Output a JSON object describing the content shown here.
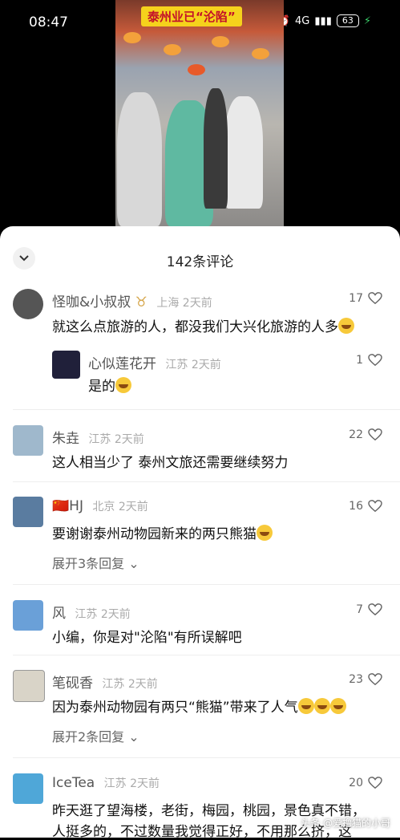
{
  "status_bar": {
    "time": "08:47",
    "network": "4G",
    "battery": "63"
  },
  "video": {
    "banner": "泰州业已“沦陷”"
  },
  "sheet": {
    "title": "142条评论"
  },
  "comments": [
    {
      "name": "怪咖&小叔叔",
      "badge": "♉",
      "location": "上海",
      "time": "2天前",
      "likes": "17",
      "text": "就这么点旅游的人，都没我们大兴化旅游的人多"
    },
    {
      "name": "心似莲花开",
      "location": "江苏",
      "time": "2天前",
      "likes": "1",
      "text": "是的"
    },
    {
      "name": "朱垚",
      "location": "江苏",
      "time": "2天前",
      "likes": "22",
      "text": "这人相当少了 泰州文旅还需要继续努力"
    },
    {
      "name": "HJ",
      "flag": "🇨🇳",
      "location": "北京",
      "time": "2天前",
      "likes": "16",
      "text": "要谢谢泰州动物园新来的两只熊猫",
      "expand": "展开3条回复"
    },
    {
      "name": "风",
      "location": "江苏",
      "time": "2天前",
      "likes": "7",
      "text": "小编，你是对\"沦陷\"有所误解吧"
    },
    {
      "name": "笔砚香",
      "location": "江苏",
      "time": "2天前",
      "likes": "23",
      "text": "因为泰州动物园有两只“熊猫”带来了人气",
      "expand": "展开2条回复"
    },
    {
      "name": "IceTea",
      "location": "江苏",
      "time": "2天前",
      "likes": "20",
      "text1": "昨天逛了望海楼，老街，梅园，桃园，景色真不错，",
      "text2": "人挺多的，不过数量我觉得正好，不用那么挤，这"
    }
  ],
  "watermark": "头条 @爱撸猫的小哥",
  "colors": {
    "accent_banner": "#f5d21c",
    "banner_text": "#c3102a",
    "meta": "#aaaaaa"
  }
}
